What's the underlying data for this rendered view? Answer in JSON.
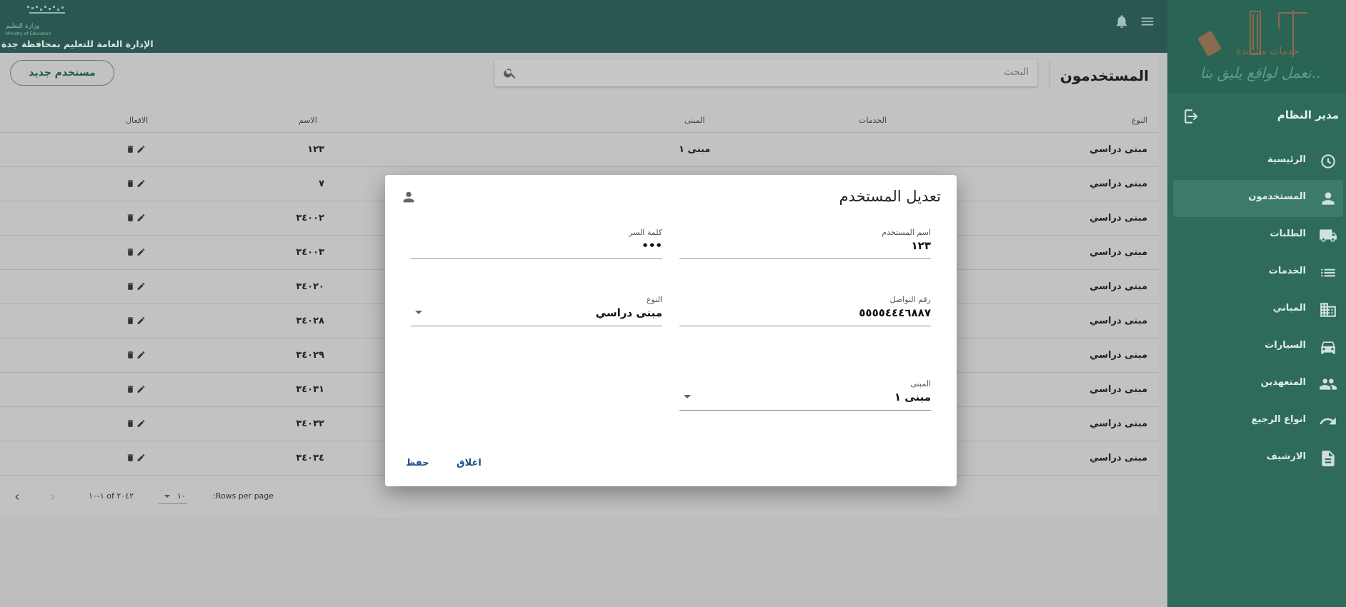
{
  "header": {
    "ministry_small": "وزارة التعليم",
    "ministry_small_en": "Ministry of Education",
    "org_title": "الإدارة العامة للتعليم بمحافظة جدة"
  },
  "sidebar": {
    "slogan": "نعمل لواقع يليق بنا..",
    "admin_label": "مدير النظام",
    "items": [
      {
        "label": "الرئيسية",
        "icon": "dashboard-icon",
        "active": false
      },
      {
        "label": "المستخدمون",
        "icon": "person-icon",
        "active": true
      },
      {
        "label": "الطلبات",
        "icon": "truck-icon",
        "active": false
      },
      {
        "label": "الخدمات",
        "icon": "list-icon",
        "active": false
      },
      {
        "label": "المباني",
        "icon": "building-icon",
        "active": false
      },
      {
        "label": "السيارات",
        "icon": "car-icon",
        "active": false
      },
      {
        "label": "المتعهدين",
        "icon": "people-icon",
        "active": false
      },
      {
        "label": "انواع الرجيع",
        "icon": "undo-icon",
        "active": false
      },
      {
        "label": "الارشيف",
        "icon": "document-icon",
        "active": false
      }
    ]
  },
  "main": {
    "title": "المستخدمون",
    "search_placeholder": "البحث",
    "new_user_label": "مستخدم جديد",
    "columns": {
      "type": "النوع",
      "services": "الخدمات",
      "building": "المبنى",
      "name": "الاسم",
      "actions": "الافعال"
    },
    "rows": [
      {
        "type": "مبنى دراسي",
        "building": "مبنى ١",
        "name": "١٢٣"
      },
      {
        "type": "مبنى دراسي",
        "building": "",
        "name": "٧"
      },
      {
        "type": "مبنى دراسي",
        "building": "",
        "name": "٣٤٠٠٢"
      },
      {
        "type": "مبنى دراسي",
        "building": "",
        "name": "٣٤٠٠٣"
      },
      {
        "type": "مبنى دراسي",
        "building": "",
        "name": "٣٤٠٢٠"
      },
      {
        "type": "مبنى دراسي",
        "building": "",
        "name": "٣٤٠٢٨"
      },
      {
        "type": "مبنى دراسي",
        "building": "",
        "name": "٣٤٠٢٩"
      },
      {
        "type": "مبنى دراسي",
        "building": "",
        "name": "٣٤٠٣١"
      },
      {
        "type": "مبنى دراسي",
        "building": "",
        "name": "٣٤٠٣٢"
      },
      {
        "type": "مبنى دراسي",
        "building": "",
        "name": "٣٤٠٣٤"
      }
    ],
    "pagination": {
      "rows_per_page_label": ":Rows per page",
      "rows_per_page_value": "١٠",
      "range_text": "١-١٠ of ٢٠٤٢"
    }
  },
  "dialog": {
    "title": "تعديل المستخدم",
    "fields": {
      "username_label": "اسم المستخدم",
      "username_value": "١٢٣",
      "password_label": "كلمة السر",
      "password_value": "•••",
      "phone_label": "رقم التواصل",
      "phone_value": "٥٥٥٥٤٤٤٦٨٨٧",
      "type_label": "النوع",
      "type_value": "مبنى دراسي",
      "building_label": "المبنى",
      "building_value": "مبنى ١"
    },
    "close_label": "اغلاق",
    "save_label": "حفظ"
  },
  "colors": {
    "topbar": "#2a574f",
    "sidebar": "#2e6b5b",
    "accent_text": "#1d4f8a"
  }
}
